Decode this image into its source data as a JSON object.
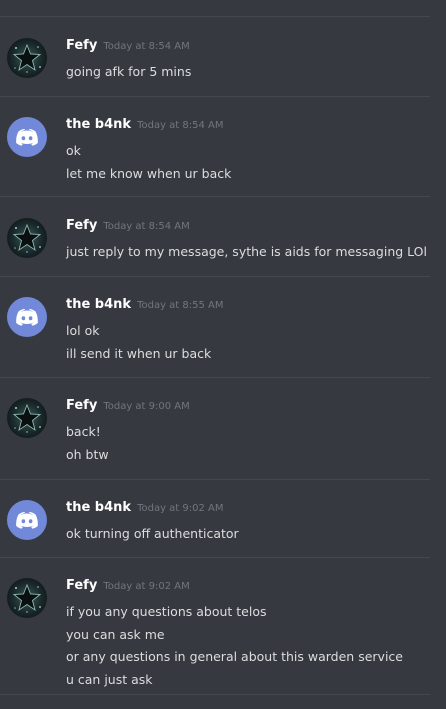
{
  "messages": [
    {
      "author": "Fefy",
      "avatar": "star-avatar-icon",
      "timestamp": "Today at 8:54 AM",
      "lines": [
        "going afk for 5 mins"
      ]
    },
    {
      "author": "the b4nk",
      "avatar": "discord-avatar-icon",
      "timestamp": "Today at 8:54 AM",
      "lines": [
        "ok",
        "let me know when ur back"
      ]
    },
    {
      "author": "Fefy",
      "avatar": "star-avatar-icon",
      "timestamp": "Today at 8:54 AM",
      "lines": [
        "just reply to my message, sythe is aids for messaging LOl"
      ]
    },
    {
      "author": "the b4nk",
      "avatar": "discord-avatar-icon",
      "timestamp": "Today at 8:55 AM",
      "lines": [
        "lol ok",
        "ill send it when ur back"
      ]
    },
    {
      "author": "Fefy",
      "avatar": "star-avatar-icon",
      "timestamp": "Today at 9:00 AM",
      "lines": [
        "back!",
        "oh btw"
      ]
    },
    {
      "author": "the b4nk",
      "avatar": "discord-avatar-icon",
      "timestamp": "Today at 9:02 AM",
      "lines": [
        "ok turning off authenticator"
      ]
    },
    {
      "author": "Fefy",
      "avatar": "star-avatar-icon",
      "timestamp": "Today at 9:02 AM",
      "lines": [
        "if you any questions about telos",
        "you can ask me",
        "or any questions in general about this warden service",
        "u can just ask"
      ]
    }
  ],
  "colors": {
    "background": "#36393f",
    "divider": "#44474d",
    "username": "#ffffff",
    "timestamp": "#72767d",
    "text": "#dcddde",
    "discord_blurple": "#7289da"
  }
}
